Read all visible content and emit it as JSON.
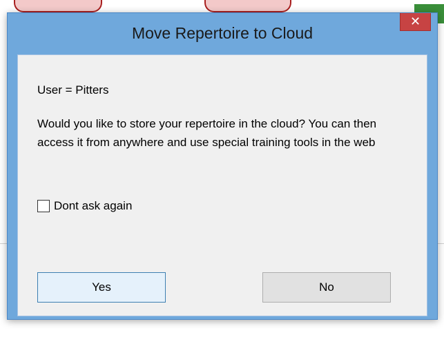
{
  "dialog": {
    "title": "Move Repertoire to Cloud",
    "close_label": "✕",
    "user_line": "User = Pitters",
    "message": "Would you like to store your repertoire in the cloud? You can then access it from anywhere and use special training tools in the web",
    "checkbox": {
      "label": "Dont ask again",
      "checked": false
    },
    "buttons": {
      "yes": "Yes",
      "no": "No"
    }
  },
  "colors": {
    "frame": "#6fa8dc",
    "close_button": "#c74343",
    "client_background": "#f0f0f0",
    "default_button_border": "#3c7fb1"
  },
  "icons": {
    "close": "close-icon"
  }
}
